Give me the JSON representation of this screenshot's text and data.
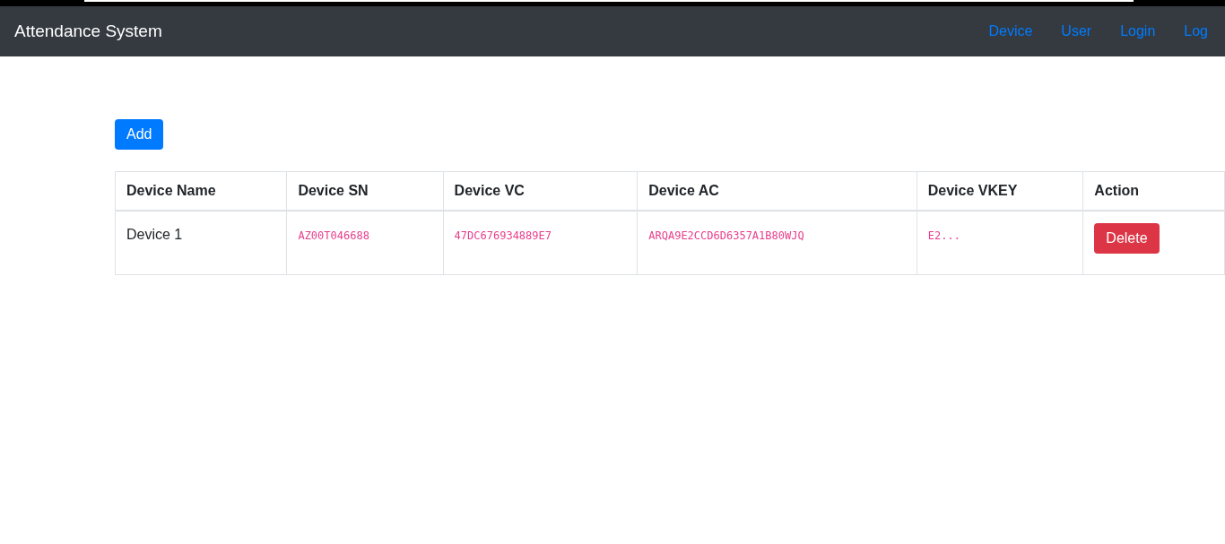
{
  "navbar": {
    "brand": "Attendance System",
    "links": [
      "Device",
      "User",
      "Login",
      "Log"
    ]
  },
  "add_button": "Add",
  "table": {
    "columns": [
      "Device Name",
      "Device SN",
      "Device VC",
      "Device AC",
      "Device VKEY",
      "Action"
    ],
    "rows": [
      {
        "name": "Device 1",
        "sn": "AZ00T046688",
        "vc": "47DC676934889E7",
        "ac": "ARQA9E2CCD6D6357A1B80WJQ",
        "vkey": "E2...",
        "action": "Delete"
      }
    ]
  }
}
